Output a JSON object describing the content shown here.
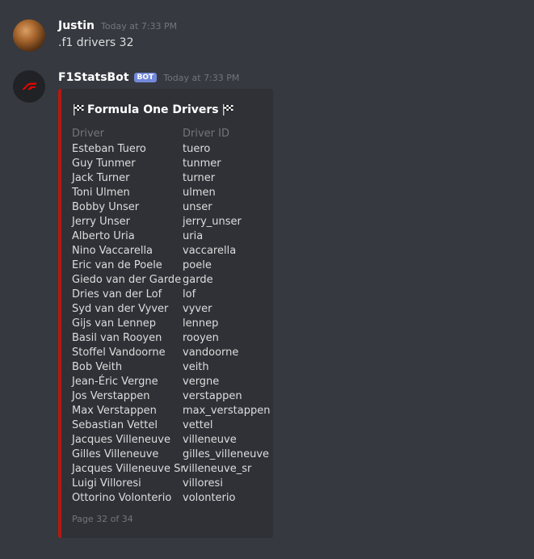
{
  "messages": [
    {
      "username": "Justin",
      "timestamp": "Today at 7:33 PM",
      "content": ".f1 drivers 32"
    },
    {
      "username": "F1StatsBot",
      "bot_tag": "BOT",
      "timestamp": "Today at 7:33 PM"
    }
  ],
  "embed": {
    "title": "Formula One Drivers",
    "accent_color": "#b31a10",
    "columns": [
      "Driver",
      "Driver ID"
    ],
    "drivers": [
      "Esteban Tuero",
      "Guy Tunmer",
      "Jack Turner",
      "Toni Ulmen",
      "Bobby Unser",
      "Jerry Unser",
      "Alberto Uria",
      "Nino Vaccarella",
      "Eric van de Poele",
      "Giedo van der Garde",
      "Dries van der Lof",
      "Syd van der Vyver",
      "Gijs van Lennep",
      "Basil van Rooyen",
      "Stoffel Vandoorne",
      "Bob Veith",
      "Jean-Éric Vergne",
      "Jos Verstappen",
      "Max Verstappen",
      "Sebastian Vettel",
      "Jacques Villeneuve",
      "Gilles Villeneuve",
      "Jacques Villeneuve Sr.",
      "Luigi Villoresi",
      "Ottorino Volonterio"
    ],
    "driver_ids": [
      "tuero",
      "tunmer",
      "turner",
      "ulmen",
      "unser",
      "jerry_unser",
      "uria",
      "vaccarella",
      "poele",
      "garde",
      "lof",
      "vyver",
      "lennep",
      "rooyen",
      "vandoorne",
      "veith",
      "vergne",
      "verstappen",
      "max_verstappen",
      "vettel",
      "villeneuve",
      "gilles_villeneuve",
      "villeneuve_sr",
      "villoresi",
      "volonterio"
    ],
    "footer": "Page 32 of 34"
  },
  "icons": {
    "user_avatar": "cat-avatar",
    "bot_avatar": "f1-logo",
    "title_flags": "chequered-flag-icon"
  }
}
